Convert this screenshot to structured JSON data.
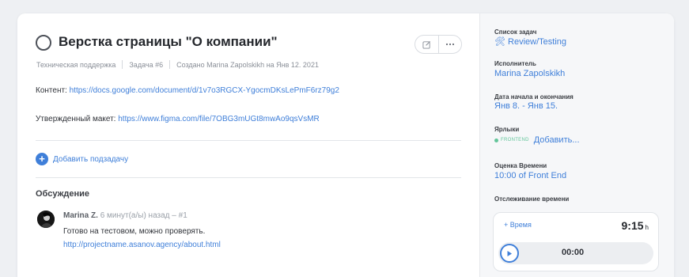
{
  "task": {
    "title": "Верстка страницы \"О компании\"",
    "meta": {
      "project": "Техническая поддержка",
      "task_number": "Задача #6",
      "created": "Создано Marina Zapolskikh на Янв 12. 2021"
    },
    "content_label": "Контент:",
    "content_url": "https://docs.google.com/document/d/1v7o3RGCX-YgocmDKsLePmF6rz79g2",
    "mockup_label": "Утвержденный макет:",
    "mockup_url": "https://www.figma.com/file/7OBG3mUGt8mwAo9qsVsMR",
    "add_subtask": "Добавить подзадачу"
  },
  "discussion": {
    "title": "Обсуждение",
    "comments": [
      {
        "author": "Marina Z.",
        "time": "6 минут(а/ы) назад – #1",
        "text": "Готово на тестовом, можно проверять.",
        "link": "http://projectname.asanov.agency/about.html"
      }
    ]
  },
  "sidebar": {
    "tasklist_label": "Список задач",
    "tasklist_value": "🛠 Review/Testing",
    "assignee_label": "Исполнитель",
    "assignee_value": "Marina Zapolskikh",
    "dates_label": "Дата начала и окончания",
    "dates_value": "Янв 8. - Янв 15.",
    "tags_label": "Ярлыки",
    "tag": "FRONTEND",
    "tag_add": "Добавить...",
    "estimate_label": "Оценка Времени",
    "estimate_value": "10:00 of Front End",
    "tracking_label": "Отслеживание времени",
    "timer": {
      "add_time": "+ Время",
      "total": "9:15",
      "total_unit": "h",
      "clock": "00:00"
    }
  },
  "colors": {
    "accent": "#3f7fd9",
    "tag": "#63c59a",
    "background": "#eef0f3"
  },
  "icons": [
    "checkbox-circle-icon",
    "edit-icon",
    "more-icon",
    "plus-icon",
    "avatar",
    "play-icon"
  ]
}
